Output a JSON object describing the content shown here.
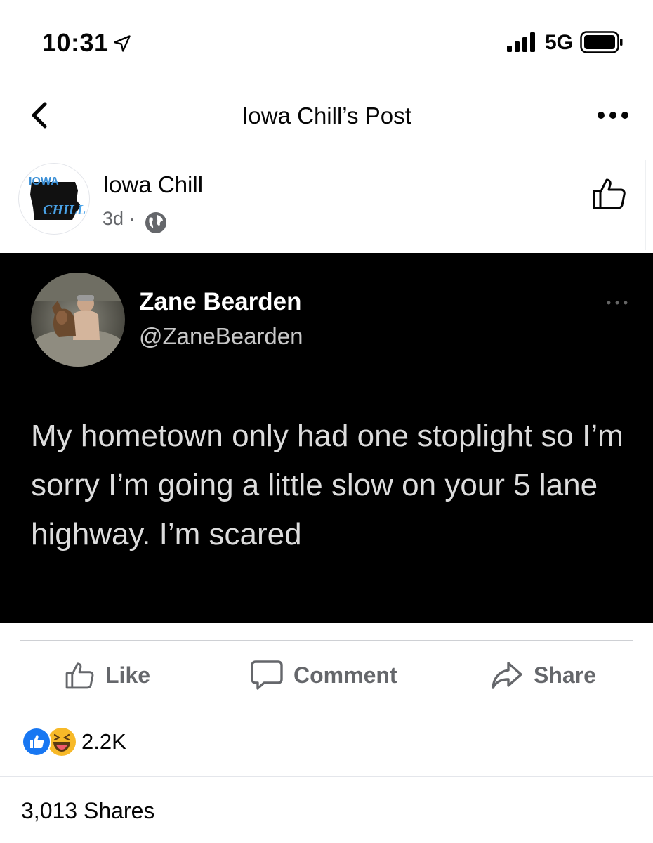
{
  "status_bar": {
    "time": "10:31",
    "network": "5G",
    "icons": [
      "location-arrow-icon",
      "signal-bars-icon",
      "battery-icon"
    ]
  },
  "nav": {
    "title": "Iowa Chill’s Post",
    "icons": [
      "back-chevron-icon",
      "more-dots-icon"
    ]
  },
  "post": {
    "page_name": "Iowa Chill",
    "time_ago": "3d ·",
    "logo_text_top": "IOWA",
    "logo_text_bottom": "CHILL",
    "icons": [
      "globe-icon",
      "thumbs-up-icon"
    ]
  },
  "tweet": {
    "display_name": "Zane Bearden",
    "handle": "@ZaneBearden",
    "text": "My hometown only had one stoplight so I’m sorry I’m going a little slow on your 5 lane highway. I’m scared"
  },
  "actions": {
    "like_label": "Like",
    "comment_label": "Comment",
    "share_label": "Share"
  },
  "reactions": {
    "count": "2.2K",
    "types": [
      "like",
      "haha"
    ]
  },
  "shares_text": "3,013 Shares",
  "colors": {
    "text_primary": "#050505",
    "text_secondary": "#65676b",
    "like_blue": "#1877f2",
    "haha_yellow": "#f7b928",
    "tweet_bg": "#000000"
  }
}
